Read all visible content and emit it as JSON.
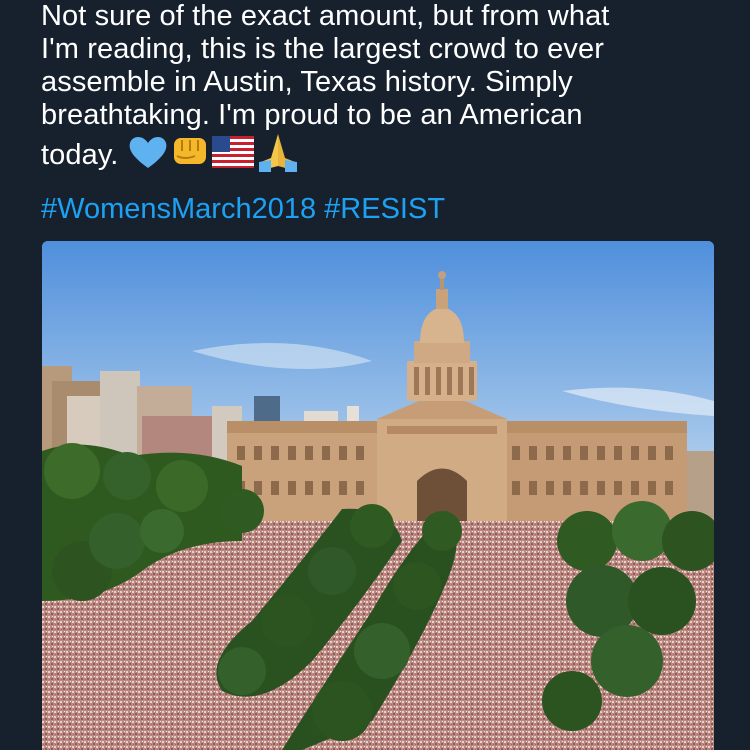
{
  "tweet": {
    "text_lines": [
      "Not sure of the exact amount, but from what",
      "I'm reading, this is the largest crowd to ever",
      "assemble in Austin, Texas history. Simply",
      "breathtaking. I'm proud to be an American",
      "today."
    ],
    "emojis": [
      "blue-heart-icon",
      "fist-icon",
      "us-flag-icon",
      "praying-hands-icon"
    ],
    "hashtags": [
      "#WomensMarch2018",
      "#RESIST"
    ]
  },
  "media": {
    "icon": "photo-of-crowd-at-texas-capitol",
    "colors": {
      "sky_top": "#4f8fdc",
      "sky_bottom": "#bcd6ee",
      "building": "#c9a27c",
      "trees": "#2f5a1f",
      "crowd": "#b98a82"
    }
  }
}
